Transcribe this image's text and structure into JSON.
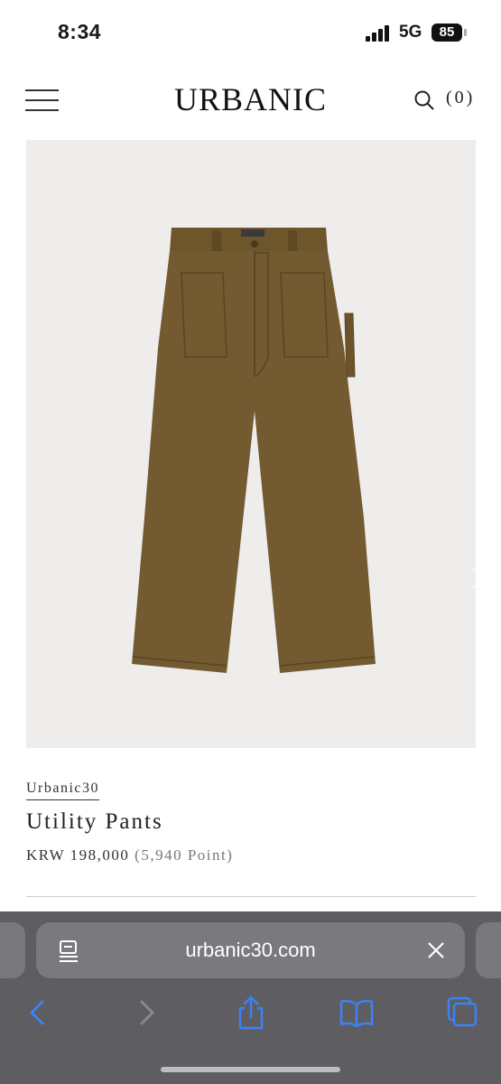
{
  "status_bar": {
    "time": "8:34",
    "network": "5G",
    "battery": "85"
  },
  "header": {
    "brand": "URBANIC",
    "cart_count": "(0)"
  },
  "product": {
    "brand_link": "Urbanic30",
    "name": "Utility Pants",
    "price": "KRW 198,000",
    "points": "(5,940 Point)",
    "image_color": "#735a30"
  },
  "browser": {
    "url": "urbanic30.com"
  },
  "icons": [
    "hamburger-menu-icon",
    "search-icon",
    "chevron-right-icon",
    "page-menu-icon",
    "close-icon",
    "back-icon",
    "forward-icon",
    "share-icon",
    "bookmarks-icon",
    "tabs-icon"
  ],
  "colors": {
    "toolbar_accent": "#3b82f6",
    "chrome_bg": "#5e5e62"
  }
}
